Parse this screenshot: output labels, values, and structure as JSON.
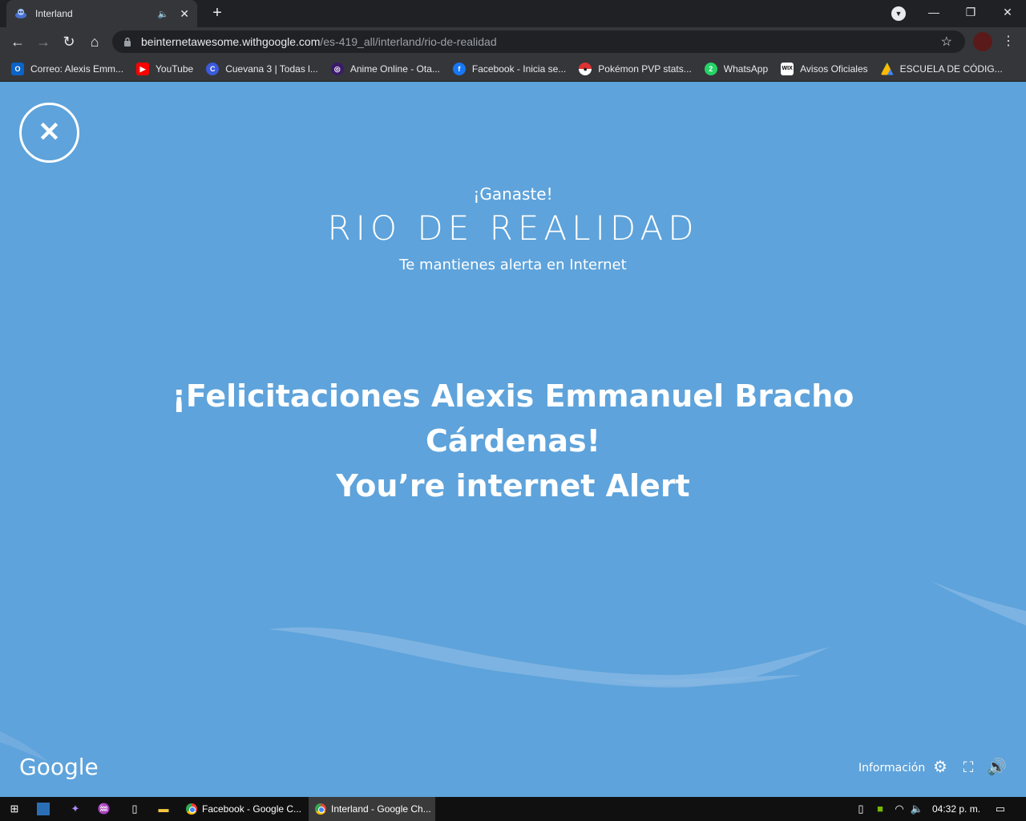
{
  "browser": {
    "tab_title": "Interland",
    "url_host": "beinternetawesome.withgoogle.com",
    "url_path": "/es-419_all/interland/rio-de-realidad",
    "new_tab_symbol": "+",
    "window_controls": {
      "minimize": "—",
      "restore": "❐",
      "close": "✕"
    }
  },
  "bookmarks": [
    {
      "label": "Correo: Alexis Emm...",
      "icon": "outlook-icon",
      "color": "#0a64c8",
      "glyph": "O"
    },
    {
      "label": "YouTube",
      "icon": "youtube-icon",
      "color": "#ff0000",
      "glyph": "▶"
    },
    {
      "label": "Cuevana 3 | Todas l...",
      "icon": "cuevana-icon",
      "color": "#3b5bdb",
      "glyph": "C"
    },
    {
      "label": "Anime Online - Ota...",
      "icon": "anime-icon",
      "color": "#3a1a6a",
      "glyph": "◎"
    },
    {
      "label": "Facebook - Inicia se...",
      "icon": "facebook-icon",
      "color": "#1877f2",
      "glyph": "f"
    },
    {
      "label": "Pokémon PVP stats...",
      "icon": "pokeball-icon",
      "color": "#d33",
      "glyph": "●"
    },
    {
      "label": "WhatsApp",
      "icon": "whatsapp-icon",
      "color": "#25d366",
      "glyph": "2"
    },
    {
      "label": "Avisos Oficiales",
      "icon": "wix-icon",
      "color": "#ffffff",
      "glyph": "WIX"
    },
    {
      "label": "ESCUELA DE CÓDIG...",
      "icon": "drive-icon",
      "color": "#fbbc05",
      "glyph": "▲"
    }
  ],
  "game": {
    "ganaste": "¡Ganaste!",
    "title": "RIO DE REALIDAD",
    "subtitle": "Te mantienes alerta en Internet",
    "congrats_line1": "¡Felicitaciones Alexis Emmanuel Bracho",
    "congrats_line2": "Cárdenas!",
    "congrats_line3": "You’re internet Alert",
    "logo": "Google",
    "info_label": "Información",
    "background_color": "#5ea3db"
  },
  "taskbar": {
    "apps": [
      {
        "label": "Facebook - Google C...",
        "active": false
      },
      {
        "label": "Interland - Google Ch...",
        "active": true
      }
    ],
    "clock": "04:32 p. m."
  }
}
